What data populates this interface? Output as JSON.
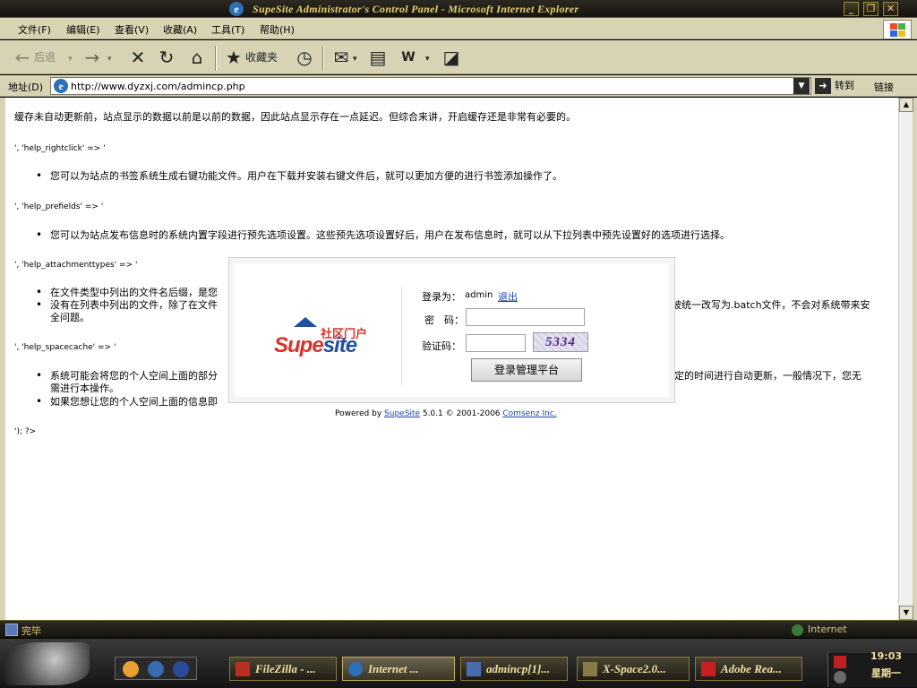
{
  "window": {
    "title": "SupeSite Administrator's Control Panel - Microsoft Internet Explorer",
    "minimize": "_",
    "restore": "❐",
    "close": "✕"
  },
  "menu": [
    "文件(F)",
    "编辑(E)",
    "查看(V)",
    "收藏(A)",
    "工具(T)",
    "帮助(H)"
  ],
  "toolbar": {
    "back": "后退",
    "favorites": "收藏夹"
  },
  "address": {
    "label": "地址(D)",
    "url": "http://www.dyzxj.com/admincp.php",
    "go": "转到",
    "links": "链接"
  },
  "page": {
    "line1": "缓存未自动更新前，站点显示的数据以前是以前的数据，因此站点显示存在一点延迟。但综合来讲，开启缓存还是非常有必要的。",
    "key_rightclick": "', 'help_rightclick' => '",
    "item_rightclick": "您可以为站点的书签系统生成右键功能文件。用户在下载并安装右键文件后，就可以更加方便的进行书签添加操作了。",
    "key_prefields": "', 'help_prefields' => '",
    "item_prefields": "您可以为站点发布信息时的系统内置字段进行预先选项设置。这些预先选项设置好后，用户在发布信息时，就可以从下拉列表中预先设置好的选项进行选择。",
    "key_attachmenttypes": "', 'help_attachmenttypes' => '",
    "item_attach1_left": "在文件类型中列出的文件名后缀，是您",
    "item_attach2_left": "没有在列表中列出的文件，除了在文件",
    "item_attach2_right": "被统一改写为.batch文件，不会对系统带来安",
    "item_attach2_cont": "全问题。",
    "key_spacecache": "', 'help_spacecache' => '",
    "item_space1_left": "系统可能会将您的个人空间上面的部分",
    "item_space1_right": "一定的时间进行自动更新，一般情况下，您无",
    "item_space1_cont": "需进行本操作。",
    "item_space2_left": "如果您想让您的个人空间上面的信息即",
    "end": "'); ?>"
  },
  "login": {
    "logo_cn": "社区门户",
    "logo_supe": "Supe",
    "logo_site": "site",
    "login_as_label": "登录为：",
    "username": "admin",
    "logout": "退出",
    "password_label": "密　码：",
    "captcha_label": "验证码：",
    "captcha_text": "5334",
    "submit": "登录管理平台",
    "powered_prefix": "Powered by ",
    "powered_product": "SupeSite",
    "powered_version": " 5.0.1 © 2001-2006 ",
    "powered_company": "Comsenz Inc."
  },
  "status": {
    "text": "完毕",
    "zone": "Internet"
  },
  "taskbar": {
    "tasks": [
      "FileZilla - ...",
      "Internet ...",
      "admincp[1]...",
      "X-Space2.0...",
      "Adobe Rea..."
    ],
    "clock_time": "19:03",
    "clock_day": "星期一"
  }
}
